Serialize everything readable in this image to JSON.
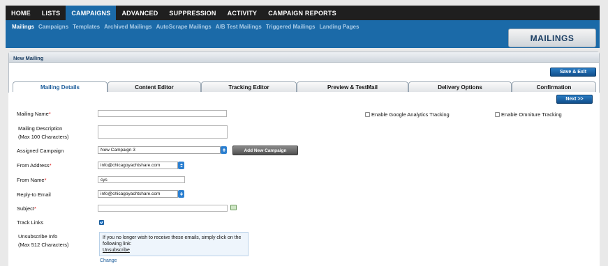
{
  "top_nav": [
    {
      "label": "HOME",
      "active": false
    },
    {
      "label": "LISTS",
      "active": false
    },
    {
      "label": "CAMPAIGNS",
      "active": true
    },
    {
      "label": "ADVANCED",
      "active": false
    },
    {
      "label": "SUPPRESSION",
      "active": false
    },
    {
      "label": "ACTIVITY",
      "active": false
    },
    {
      "label": "CAMPAIGN REPORTS",
      "active": false
    }
  ],
  "sub_nav": [
    {
      "label": "Mailings",
      "active": true
    },
    {
      "label": "Campaigns",
      "active": false
    },
    {
      "label": "Templates",
      "active": false
    },
    {
      "label": "Archived Mailings",
      "active": false
    },
    {
      "label": "AutoScrape Mailings",
      "active": false
    },
    {
      "label": "A/B Test Mailings",
      "active": false
    },
    {
      "label": "Triggered Mailings",
      "active": false
    },
    {
      "label": "Landing Pages",
      "active": false
    }
  ],
  "section_title": "MAILINGS",
  "panel_title": "New Mailing",
  "save_exit_label": "Save & Exit",
  "next_label": "Next >>",
  "tabs": [
    {
      "label": "Mailing Details",
      "active": true
    },
    {
      "label": "Content Editor",
      "active": false
    },
    {
      "label": "Tracking Editor",
      "active": false
    },
    {
      "label": "Preview & TestMail",
      "active": false
    },
    {
      "label": "Delivery Options",
      "active": false
    },
    {
      "label": "Confirmation",
      "active": false
    }
  ],
  "form": {
    "mailing_name": {
      "label": "Mailing Name",
      "value": ""
    },
    "mailing_description": {
      "label_line1": "Mailing Description",
      "label_line2": "(Max 100 Characters)",
      "value": ""
    },
    "assigned_campaign": {
      "label": "Assigned Campaign",
      "value": "New Campaign 3"
    },
    "add_new_campaign_label": "Add New Campaign",
    "from_address": {
      "label": "From Address",
      "value": "info@chicagoyachtshare.com"
    },
    "from_name": {
      "label": "From Name",
      "value": "cys"
    },
    "reply_to": {
      "label": "Reply-to Email",
      "value": "info@chicagoyachtshare.com"
    },
    "subject": {
      "label": "Subject",
      "value": ""
    },
    "track_links": {
      "label": "Track Links",
      "checked": true
    },
    "unsubscribe": {
      "label_line1": "Unsubscribe Info",
      "label_line2": "(Max 512 Characters)",
      "text": "If you no longer wish to receive these emails, simply click on the following link:",
      "link_text": "Unsubscribe",
      "change_label": "Change"
    },
    "google_analytics": {
      "label": "Enable Google Analytics Tracking",
      "checked": false
    },
    "omniture": {
      "label": "Enable Omniture Tracking",
      "checked": false
    }
  }
}
